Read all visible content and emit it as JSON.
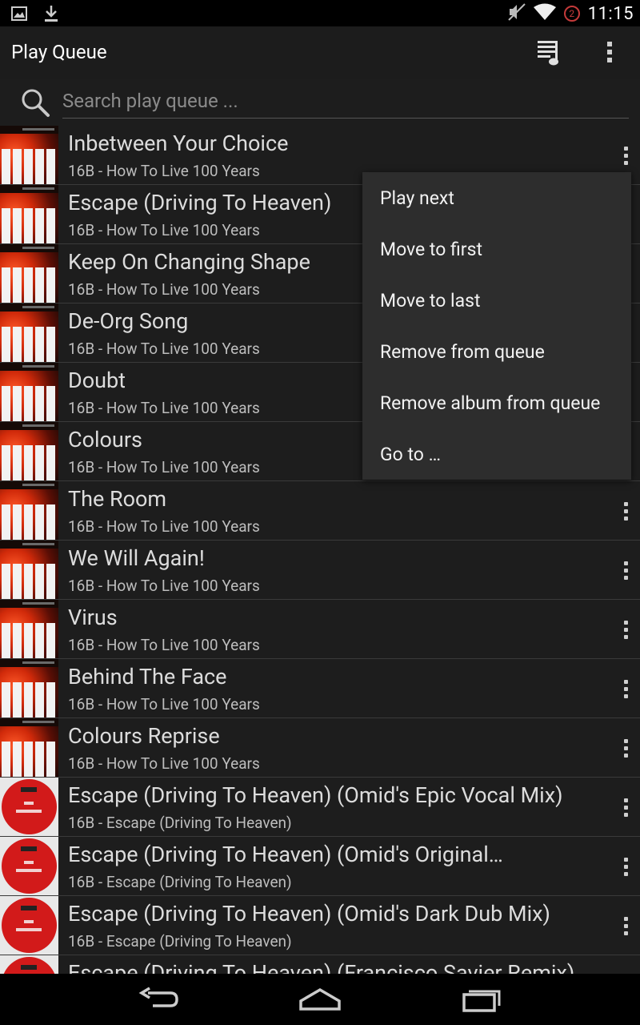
{
  "status_bar": {
    "time": "11:15",
    "notification_count": "2",
    "left_icons": [
      "picture-icon",
      "download-icon"
    ],
    "right_icons": [
      "mute-icon",
      "wifi-icon"
    ]
  },
  "action_bar": {
    "title": "Play Queue"
  },
  "search": {
    "placeholder": "Search play queue ..."
  },
  "queue": [
    {
      "title": "Inbetween Your Choice",
      "subtitle": "16B - How To Live 100 Years",
      "art": "red"
    },
    {
      "title": "Escape (Driving To Heaven)",
      "subtitle": "16B - How To Live 100 Years",
      "art": "red"
    },
    {
      "title": "Keep On Changing Shape",
      "subtitle": "16B - How To Live 100 Years",
      "art": "red"
    },
    {
      "title": "De-Org Song",
      "subtitle": "16B - How To Live 100 Years",
      "art": "red"
    },
    {
      "title": "Doubt",
      "subtitle": "16B - How To Live 100 Years",
      "art": "red"
    },
    {
      "title": "Colours",
      "subtitle": "16B - How To Live 100 Years",
      "art": "red"
    },
    {
      "title": "The Room",
      "subtitle": "16B - How To Live 100 Years",
      "art": "red"
    },
    {
      "title": "We Will Again!",
      "subtitle": "16B - How To Live 100 Years",
      "art": "red"
    },
    {
      "title": "Virus",
      "subtitle": "16B - How To Live 100 Years",
      "art": "red"
    },
    {
      "title": "Behind The Face",
      "subtitle": "16B - How To Live 100 Years",
      "art": "red"
    },
    {
      "title": "Colours Reprise",
      "subtitle": "16B - How To Live 100 Years",
      "art": "red"
    },
    {
      "title": "Escape (Driving To Heaven) (Omid's Epic Vocal Mix)",
      "subtitle": "16B - Escape (Driving To Heaven)",
      "art": "disc"
    },
    {
      "title": "Escape (Driving To Heaven) (Omid's Original…",
      "subtitle": "16B - Escape (Driving To Heaven)",
      "art": "disc"
    },
    {
      "title": "Escape (Driving To Heaven) (Omid's Dark Dub Mix)",
      "subtitle": "16B - Escape (Driving To Heaven)",
      "art": "disc"
    },
    {
      "title": "Escape (Driving To Heaven) (Francisco Savier Remix)",
      "subtitle": "",
      "art": "disc"
    }
  ],
  "context_menu": {
    "items": [
      "Play next",
      "Move to first",
      "Move to last",
      "Remove from queue",
      "Remove album from queue",
      "Go to …"
    ]
  },
  "colors": {
    "background": "#1d1d1d",
    "popup": "#2d2d2d",
    "status_bar": "#000000",
    "divider": "#3a3a3a"
  }
}
